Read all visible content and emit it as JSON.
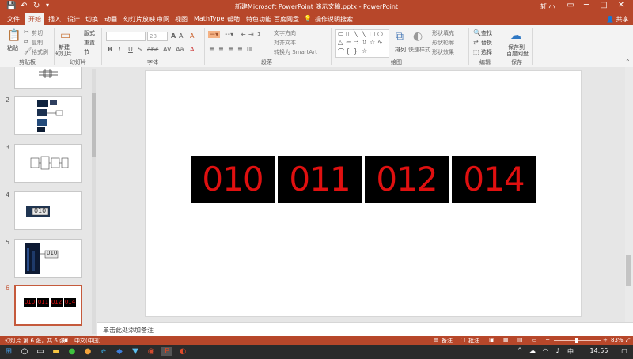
{
  "titlebar": {
    "title": "新建Microsoft PowerPoint 演示文稿.pptx  -  PowerPoint",
    "user": "轩 小",
    "save_icon": "save-icon",
    "undo_icon": "undo-icon",
    "redo_icon": "redo-icon",
    "restore_label": "▭",
    "min_label": "─",
    "max_label": "□",
    "close_label": "✕"
  },
  "tabs": [
    {
      "label": "文件"
    },
    {
      "label": "开始"
    },
    {
      "label": "插入"
    },
    {
      "label": "设计"
    },
    {
      "label": "切换"
    },
    {
      "label": "动画"
    },
    {
      "label": "幻灯片放映"
    },
    {
      "label": "审阅"
    },
    {
      "label": "视图"
    },
    {
      "label": "MathType"
    },
    {
      "label": "帮助"
    },
    {
      "label": "特色功能"
    },
    {
      "label": "百度网盘"
    },
    {
      "label": "操作说明搜索"
    }
  ],
  "share_label": "共享",
  "ribbon": {
    "clipboard": {
      "paste": "粘贴",
      "cut": "剪切",
      "copy": "复制",
      "format_painter": "格式刷",
      "group": "剪贴板"
    },
    "slides": {
      "new_slide": "新建",
      "new_slide2": "幻灯片",
      "layout": "版式",
      "reset": "重置",
      "section": "节",
      "group": "幻灯片"
    },
    "font": {
      "size": "28",
      "group": "字体"
    },
    "paragraph": {
      "text_direction": "文字方向",
      "align_text": "对齐文本",
      "smartart": "转换为 SmartArt",
      "group": "段落"
    },
    "drawing": {
      "arrange": "排列",
      "quick_styles": "快速样式",
      "fill": "形状填充",
      "outline": "形状轮廓",
      "effects": "形状效果",
      "group": "绘图"
    },
    "editing": {
      "find": "查找",
      "replace": "替换",
      "select": "选择",
      "group": "编辑"
    },
    "save": {
      "save_to": "保存到",
      "baidu": "百度网盘",
      "group": "保存"
    }
  },
  "thumbnails": [
    {
      "number": "",
      "selected": false
    },
    {
      "number": "2",
      "selected": false
    },
    {
      "number": "3",
      "selected": false
    },
    {
      "number": "4",
      "selected": false
    },
    {
      "number": "5",
      "selected": false
    },
    {
      "number": "6",
      "selected": true
    }
  ],
  "slide": {
    "digits": [
      "010",
      "011",
      "012",
      "014"
    ],
    "digit_color": "#e01010"
  },
  "notes_placeholder": "单击此处添加备注",
  "status": {
    "slide_info": "幻灯片 第 6 张，共 6 张",
    "language": "中文(中国)",
    "notes": "备注",
    "comments": "批注",
    "zoom": "83%"
  },
  "taskbar": {
    "time": "14:55"
  }
}
